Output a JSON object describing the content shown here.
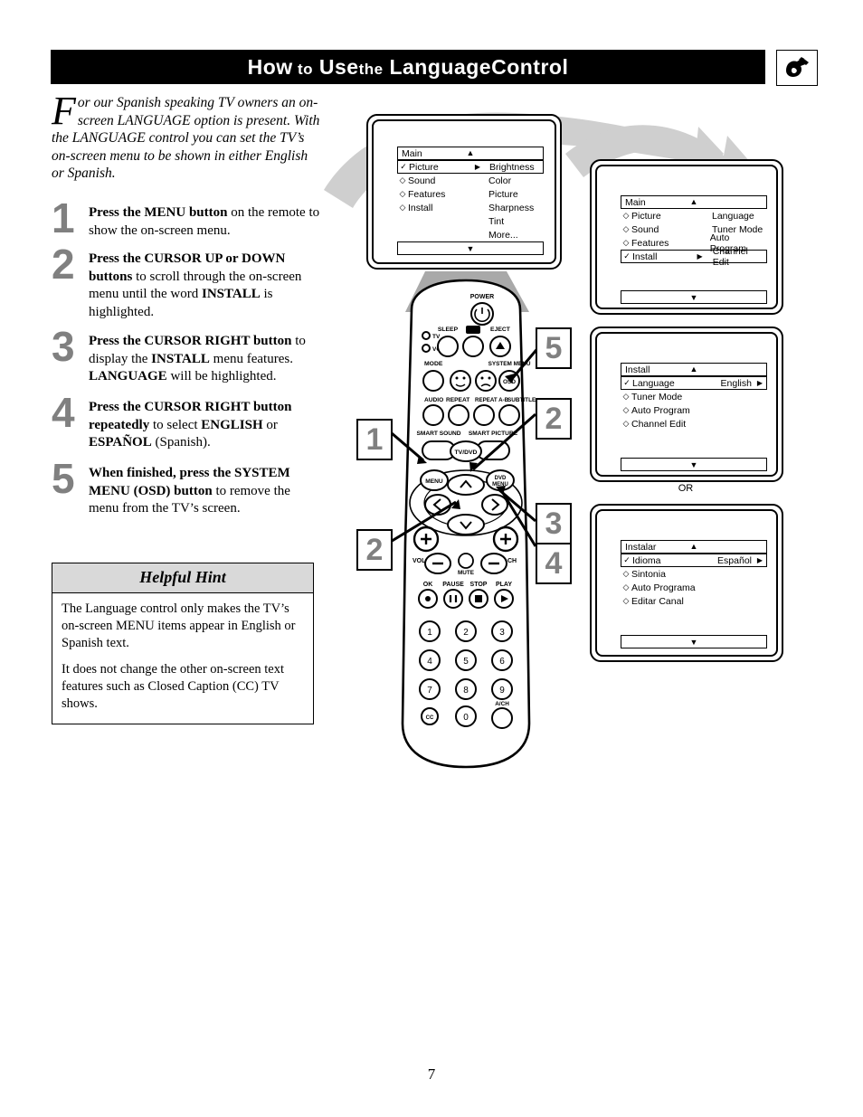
{
  "header": {
    "title_words": [
      "How",
      "to",
      "Use",
      "the",
      "Language",
      "Control"
    ],
    "title_full": "How to Use the Language Control",
    "logo_name": "philips-hook-logo"
  },
  "intro": {
    "dropcap": "F",
    "text": "or our Spanish speaking TV owners an on-screen LANGUAGE option is present. With the LANGUAGE control you can set the TV’s on-screen menu to be shown in either English or Spanish."
  },
  "steps": [
    {
      "number": "1",
      "html": "<b>Press the MENU button</b> on the remote to show the on-screen menu."
    },
    {
      "number": "2",
      "html": "<b>Press the CURSOR UP or DOWN buttons</b> to scroll through the on-screen menu until the word <b>INSTALL</b> is highlighted."
    },
    {
      "number": "3",
      "html": "<b>Press the CURSOR RIGHT button</b> to display the <b>INSTALL</b> menu features. <b>LANGUAGE</b> will be highlighted."
    },
    {
      "number": "4",
      "html": "<b>Press the CURSOR RIGHT button repeatedly</b> to select <b>ENGLISH</b> or <b>ESPAÑOL</b> (Spanish)."
    },
    {
      "number": "5",
      "html": "<b>When finished, press the SYSTEM MENU (OSD) button</b> to remove the menu from the TV’s screen."
    }
  ],
  "hint": {
    "title_words": [
      "Helpful",
      "Hint"
    ],
    "title_full": "Helpful Hint",
    "paragraphs": [
      "The Language control only makes the TV’s on-screen MENU items appear in English or Spanish text.",
      "It does not change the other on-screen text features such as Closed Caption (CC) TV shows."
    ]
  },
  "menus": [
    {
      "id": "menu-main-picture",
      "header": "Main",
      "up_caret": "▲",
      "down_caret": "▼",
      "rows": [
        {
          "mark": "✓",
          "label": "Picture",
          "selected": true,
          "arrow": "▶",
          "right": "Brightness"
        },
        {
          "mark": "◇",
          "label": "Sound",
          "selected": false,
          "arrow": "",
          "right": "Color"
        },
        {
          "mark": "◇",
          "label": "Features",
          "selected": false,
          "arrow": "",
          "right": "Picture"
        },
        {
          "mark": "◇",
          "label": "Install",
          "selected": false,
          "arrow": "",
          "right": "Sharpness"
        },
        {
          "mark": "",
          "label": "",
          "selected": false,
          "arrow": "",
          "right": "Tint"
        },
        {
          "mark": "",
          "label": "",
          "selected": false,
          "arrow": "",
          "right": "More..."
        }
      ]
    },
    {
      "id": "menu-main-install",
      "header": "Main",
      "up_caret": "▲",
      "down_caret": "▼",
      "rows": [
        {
          "mark": "◇",
          "label": "Picture",
          "selected": false,
          "arrow": "",
          "right": "Language"
        },
        {
          "mark": "◇",
          "label": "Sound",
          "selected": false,
          "arrow": "",
          "right": "Tuner Mode"
        },
        {
          "mark": "◇",
          "label": "Features",
          "selected": false,
          "arrow": "",
          "right": "Auto Program"
        },
        {
          "mark": "✓",
          "label": "Install",
          "selected": true,
          "arrow": "▶",
          "right": "Channel Edit"
        }
      ]
    },
    {
      "id": "menu-install-english",
      "header": "Install",
      "up_caret": "▲",
      "down_caret": "▼",
      "rows": [
        {
          "mark": "✓",
          "label": "Language",
          "selected": true,
          "arrow": "▶",
          "value": "English"
        },
        {
          "mark": "◇",
          "label": "Tuner Mode",
          "selected": false,
          "arrow": "",
          "value": ""
        },
        {
          "mark": "◇",
          "label": "Auto Program",
          "selected": false,
          "arrow": "",
          "value": ""
        },
        {
          "mark": "◇",
          "label": "Channel Edit",
          "selected": false,
          "arrow": "",
          "value": ""
        }
      ]
    },
    {
      "id": "menu-install-spanish",
      "header": "Instalar",
      "up_caret": "▲",
      "down_caret": "▼",
      "rows": [
        {
          "mark": "✓",
          "label": "Idioma",
          "selected": true,
          "arrow": "▶",
          "value": "Español"
        },
        {
          "mark": "◇",
          "label": "Sintonia",
          "selected": false,
          "arrow": "",
          "value": ""
        },
        {
          "mark": "◇",
          "label": "Auto Programa",
          "selected": false,
          "arrow": "",
          "value": ""
        },
        {
          "mark": "◇",
          "label": "Editar Canal",
          "selected": false,
          "arrow": "",
          "value": ""
        }
      ]
    }
  ],
  "or_label": "OR",
  "callouts": [
    {
      "id": "callout-5",
      "label": "5",
      "points_to": "osd-button"
    },
    {
      "id": "callout-2-right",
      "label": "2",
      "points_to": "cursor-up-button"
    },
    {
      "id": "callout-1",
      "label": "1",
      "points_to": "menu-button"
    },
    {
      "id": "callout-3",
      "label": "3",
      "points_to": "cursor-right-button"
    },
    {
      "id": "callout-2-left",
      "label": "2",
      "points_to": "cursor-down-button"
    },
    {
      "id": "callout-4",
      "label": "4",
      "points_to": "cursor-right-button"
    }
  ],
  "remote": {
    "labels": {
      "power": "POWER",
      "sleep": "SLEEP",
      "eject": "EJECT",
      "tv_led": "TV",
      "vcr_led": "VCR",
      "mode": "MODE",
      "system_menu": "SYSTEM MENU",
      "osd": "OSD",
      "audio": "AUDIO",
      "repeat": "REPEAT",
      "repeat_ab": "REPEAT A-B",
      "subtitle": "SUBTITLE",
      "smart_sound": "SMART SOUND",
      "tv_dvd": "TV/DVD",
      "smart_picture": "SMART PICTURE",
      "menu": "MENU",
      "dvd_menu_line1": "DVD",
      "dvd_menu_line2": "MENU",
      "vol": "VOL",
      "mute": "MUTE",
      "ch": "CH",
      "ok": "OK",
      "pause": "PAUSE",
      "stop": "STOP",
      "play": "PLAY",
      "cc": "CC",
      "a_ch": "A/CH",
      "plus": "+",
      "minus": "−"
    },
    "keypad": [
      "1",
      "2",
      "3",
      "4",
      "5",
      "6",
      "7",
      "8",
      "9",
      "CC",
      "0",
      "A/CH"
    ]
  },
  "page_number": "7",
  "colors": {
    "header_bg": "#000000",
    "header_text": "#ffffff",
    "step_number": "#808080",
    "hint_head_bg": "#d9d9d9",
    "swoosh_gray": "#c8c8c8",
    "beam_gray": "#a8a8a8"
  }
}
